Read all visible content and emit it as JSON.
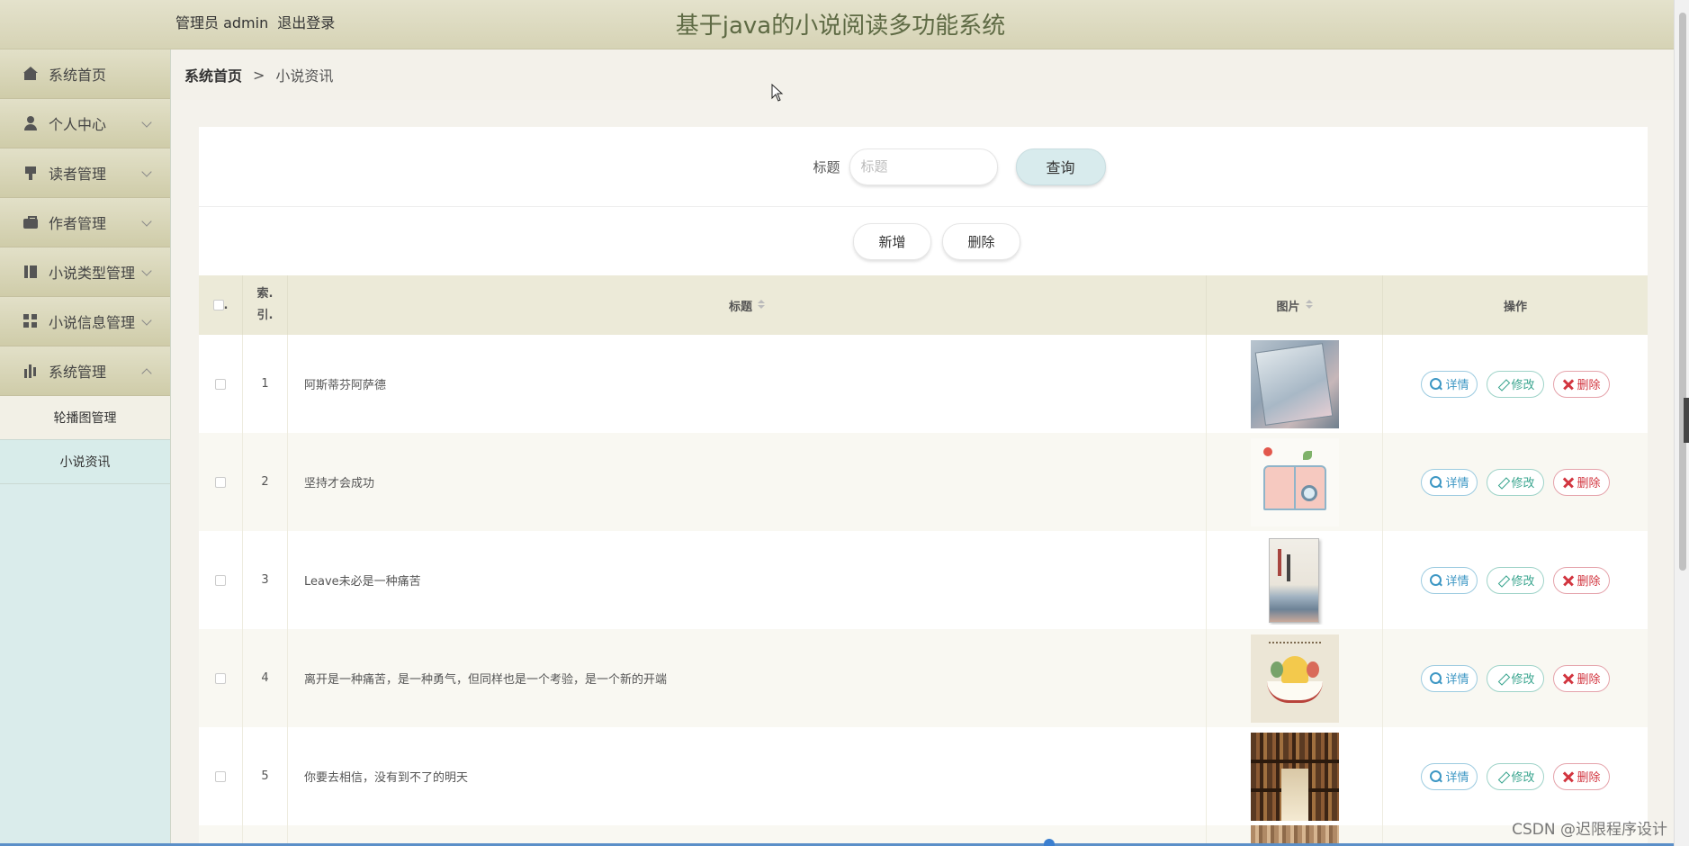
{
  "header": {
    "user_label": "管理员 admin",
    "logout": "退出登录",
    "title": "基于java的小说阅读多功能系统"
  },
  "sidebar": {
    "items": [
      {
        "label": "系统首页",
        "icon": "home-icon"
      },
      {
        "label": "个人中心",
        "icon": "user-icon"
      },
      {
        "label": "读者管理",
        "icon": "pin-icon"
      },
      {
        "label": "作者管理",
        "icon": "briefcase-icon"
      },
      {
        "label": "小说类型管理",
        "icon": "book-icon"
      },
      {
        "label": "小说信息管理",
        "icon": "grid-icon"
      },
      {
        "label": "系统管理",
        "icon": "bar-chart-icon"
      }
    ],
    "submenu": [
      "轮播图管理",
      "小说资讯"
    ]
  },
  "breadcrumb": {
    "home": "系统首页",
    "separator": ">",
    "current": "小说资讯"
  },
  "search": {
    "label": "标题",
    "placeholder": "标题",
    "query_button": "查询"
  },
  "actions": {
    "add": "新增",
    "delete": "删除"
  },
  "table": {
    "columns": {
      "checkbox": ".",
      "index": "索引.",
      "index_line1": "索.",
      "index_line2": "引.",
      "title": "标题",
      "image": "图片",
      "ops": "操作"
    },
    "rows": [
      {
        "index": "1",
        "title": "阿斯蒂芬阿萨德"
      },
      {
        "index": "2",
        "title": "坚持才会成功"
      },
      {
        "index": "3",
        "title": "Leave未必是一种痛苦"
      },
      {
        "index": "4",
        "title": "离开是一种痛苦，是一种勇气，但同样也是一个考验，是一个新的开端"
      },
      {
        "index": "5",
        "title": "你要去相信，没有到不了的明天"
      }
    ],
    "op_labels": {
      "detail": "详情",
      "edit": "修改",
      "delete": "删除"
    }
  },
  "watermark": "CSDN @迟限程序设计",
  "colors": {
    "accent": "#d8ebed",
    "sidebar_bg": "#daeceb",
    "header_title": "#5e6a44"
  }
}
